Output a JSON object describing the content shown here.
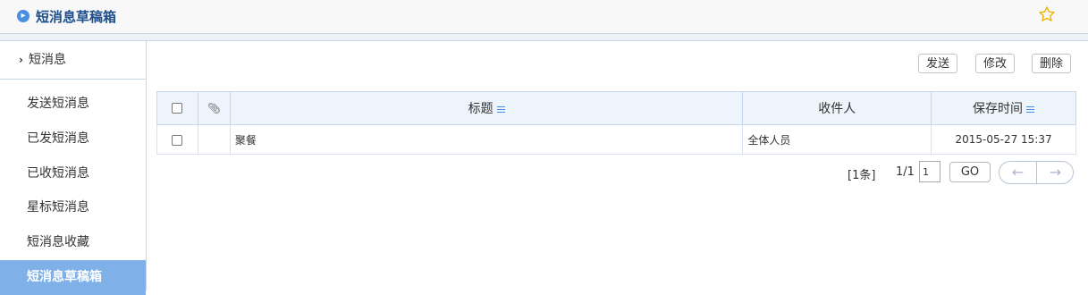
{
  "header": {
    "title": "短消息草稿箱",
    "icon": "arrow-circle-icon",
    "favorite_icon": "star-icon"
  },
  "sidebar": {
    "heading": "短消息",
    "items": [
      {
        "label": "发送短消息",
        "active": false
      },
      {
        "label": "已发短消息",
        "active": false
      },
      {
        "label": "已收短消息",
        "active": false
      },
      {
        "label": "星标短消息",
        "active": false
      },
      {
        "label": "短消息收藏",
        "active": false
      },
      {
        "label": "短消息草稿箱",
        "active": true
      }
    ]
  },
  "toolbar": {
    "send_label": "发送",
    "edit_label": "修改",
    "delete_label": "删除"
  },
  "table": {
    "headers": {
      "title": "标题",
      "recipient": "收件人",
      "saved_time": "保存时间"
    },
    "rows": [
      {
        "title": "聚餐",
        "recipient": "全体人员",
        "saved_time": "2015-05-27 15:37"
      }
    ]
  },
  "pager": {
    "count_text": "[1条]",
    "page_text": "1/1",
    "page_input": "1",
    "go_label": "GO"
  },
  "colors": {
    "accent": "#4a8fe0",
    "active_bg": "#7fb0e8",
    "header_bg": "#eef4fb",
    "border": "#c7d7ea"
  }
}
